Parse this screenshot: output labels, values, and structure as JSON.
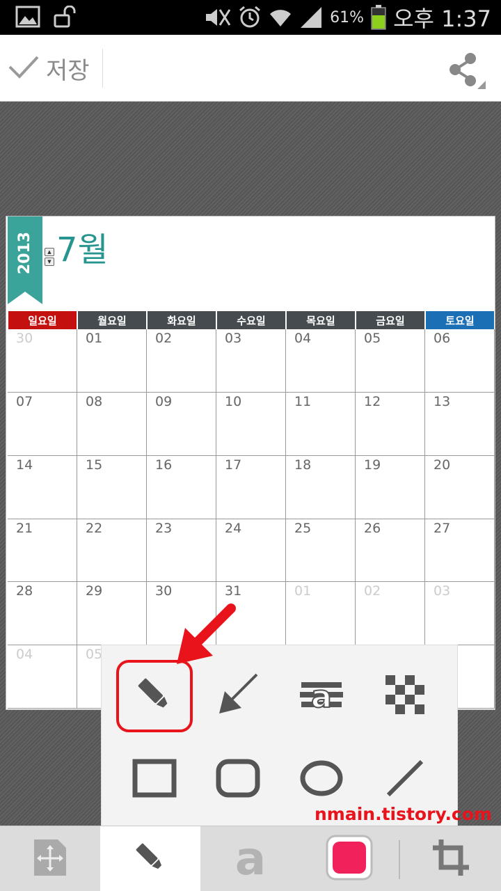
{
  "status_bar": {
    "battery": "61%",
    "time": "오후 1:37"
  },
  "action_bar": {
    "save_label": "저장"
  },
  "calendar": {
    "year": "2013",
    "month": "7월",
    "day_headers": [
      "일요일",
      "월요일",
      "화요일",
      "수요일",
      "목요일",
      "금요일",
      "토요일"
    ],
    "weeks": [
      [
        "30",
        "01",
        "02",
        "03",
        "04",
        "05",
        "06"
      ],
      [
        "07",
        "08",
        "09",
        "10",
        "11",
        "12",
        "13"
      ],
      [
        "14",
        "15",
        "16",
        "17",
        "18",
        "19",
        "20"
      ],
      [
        "21",
        "22",
        "23",
        "24",
        "25",
        "26",
        "27"
      ],
      [
        "28",
        "29",
        "30",
        "31",
        "01",
        "02",
        "03"
      ],
      [
        "04",
        "05",
        "",
        "",
        "",
        "",
        ""
      ]
    ],
    "colors": {
      "sunday": "#c4100f",
      "weekday": "#464b4f",
      "saturday": "#1a6fb5",
      "accent": "#27958f"
    }
  },
  "tools": {
    "items": [
      "pen-icon",
      "arrow-icon",
      "text-blur-icon",
      "mosaic-icon",
      "rectangle-icon",
      "rounded-rectangle-icon",
      "ellipse-icon",
      "line-icon"
    ]
  },
  "watermark": "nmain.tistory.com",
  "bottom_bar": {
    "items": [
      "move-icon",
      "pen-icon",
      "text-icon",
      "color-icon",
      "crop-icon"
    ],
    "selected_color": "#f0215b"
  }
}
